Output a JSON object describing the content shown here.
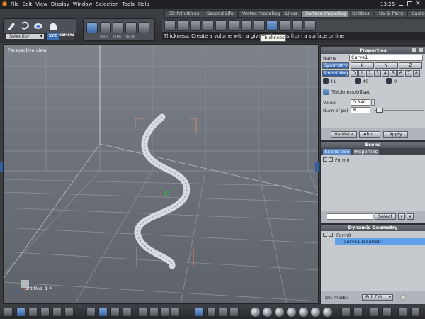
{
  "menu": [
    "File",
    "Edit",
    "View",
    "Display",
    "Window",
    "Selection",
    "Tools",
    "Help"
  ],
  "clock": "13:26",
  "tabs": [
    {
      "label": "3D Primitives",
      "active": false
    },
    {
      "label": "Second Life",
      "active": false
    },
    {
      "label": "Vertex modeling",
      "active": false
    },
    {
      "label": "Lines",
      "active": false
    },
    {
      "label": "Surface modeling",
      "active": true
    },
    {
      "label": "Utilities",
      "active": false
    },
    {
      "label": "UV & Paint",
      "active": false
    },
    {
      "label": "Custo",
      "active": false
    }
  ],
  "toolbar": {
    "selection_label": "Selection",
    "xyz_label": "XYZ",
    "camera_label": "CAMERA",
    "loop_label": "LOOP",
    "ring_label": "RING",
    "betw_label": "BETW",
    "status_text": "Thickness: Create a volume with a given thickness from a surface or line",
    "tooltip": "Thickness"
  },
  "viewport": {
    "label": "Perspective view",
    "filename": "untitled_1 *"
  },
  "properties": {
    "title": "Properties",
    "name_label": "Name",
    "name_value": "Curve1",
    "symmetry_label": "Symmetry",
    "axes": [
      "X",
      "Y",
      "Z"
    ],
    "smoothing_label": "Smoothing",
    "smoothing_levels": [
      "0",
      "1",
      "2",
      "3",
      "4",
      "5",
      "6",
      "7",
      "8"
    ],
    "count1": "41",
    "count2": "40",
    "count3": "0",
    "tool_name": "Thickness/Offset",
    "value_label": "Value",
    "value": "0.540",
    "num_label": "Num of poi",
    "num_value": "8",
    "slider_level": 0.05,
    "validate": "Validate",
    "abort": "Abort",
    "apply": "Apply"
  },
  "scene": {
    "title": "Scene",
    "tab_tree": "Scene tree",
    "tab_props": "Properties",
    "item": "Form0",
    "select_button": "Select"
  },
  "dg": {
    "title": "Dynamic Geometry",
    "form": "Form0",
    "curve": "Curve1 (control)",
    "mode_label": "DG mode:",
    "mode_value": "Full DG"
  }
}
